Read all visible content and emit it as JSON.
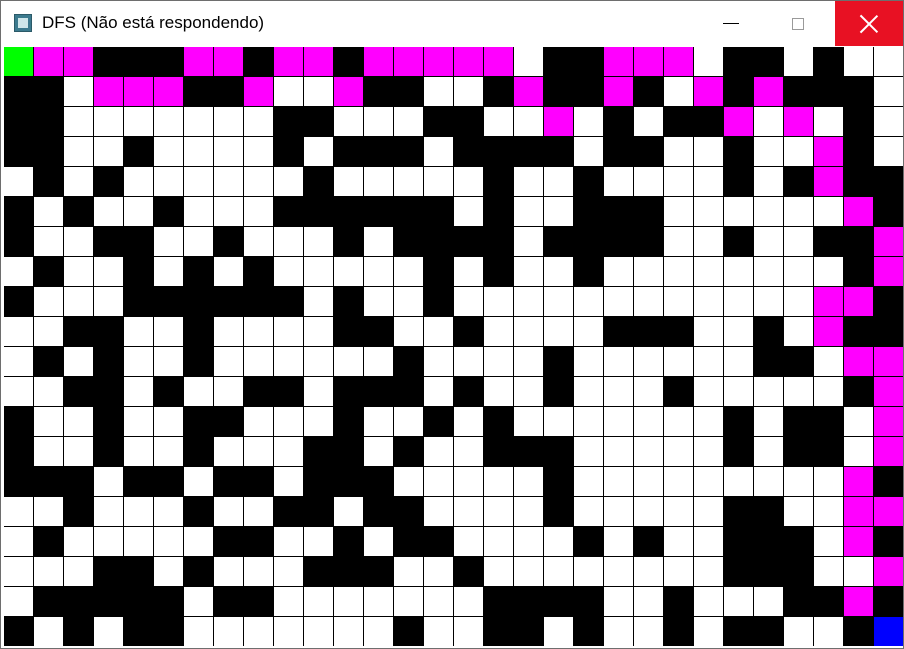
{
  "window": {
    "title": "DFS (Não está respondendo)",
    "app_icon": "python-window-icon",
    "controls": {
      "minimize_icon": "minimize-icon",
      "maximize_icon": "maximize-icon",
      "close_icon": "close-icon",
      "close_hover_color": "#e81123"
    }
  },
  "maze": {
    "rows": 20,
    "cols": 30,
    "legend": {
      "W": "#ffffff",
      "B": "#000000",
      "P": "#ff00ff",
      "G": "#00ff00",
      "U": "#0000ff"
    },
    "grid": [
      "GPPBBBPPBPPBPPPPPWBBPPPWBBWBWW",
      "BBWPPPBBPWWPBBWWBPBBPBWPBPBBBW",
      "BBWWWWWWWBBWWWBBWWPWBWBBPWPWBW",
      "BBWWBWWWWBWBBBWBBBBWBBWWBWWPBW",
      "WBWBWWWWWWBWWWWWBWWBWWWWBWBPBB",
      "BWBWWBWWWBBBBBBWBWWBBBWWWWWWPB",
      "BWWBBWWBWWWBWBBBBWBBBBWWBWWBBP",
      "WBWWBWBWBWWWWWBWBWWBWWWWWWWWBP",
      "BWWWBBBBBBWBWWBWWWWWWWWWWWWPPB",
      "WWBBWWBWWWWBBWWBWWWWBBBWWBWPBB",
      "WBWBWWBWWWWWWBWWWWBWWWWWWBBWPPW",
      "WWBBWBWWBBWBBBWBWWBWWWBWWWWWBP",
      "BWWBWWBBWWWBWWBWBWWWWWWWBWBBWP",
      "BWWBWWBWWWBBWBWWBBBWWWWWBWBBWP",
      "BBBWBBWBBWBBBWWWWWBWWWWWWWWWPB",
      "WWBWWWBWWBBWBBWWWWBWWWWWBBWWPP",
      "WBWWWWWBBWWBWBBWWWWBWBWWBBBWPB",
      "WWWBBWBWWWBBBWWBWWWWWWWWBBBWWP",
      "WBBBBBWBBWWWWWWWBBBBWWBWWWBBPB",
      "BWBWBBWWWWWWWBWWBBWBWWBWBBWWBU"
    ]
  }
}
